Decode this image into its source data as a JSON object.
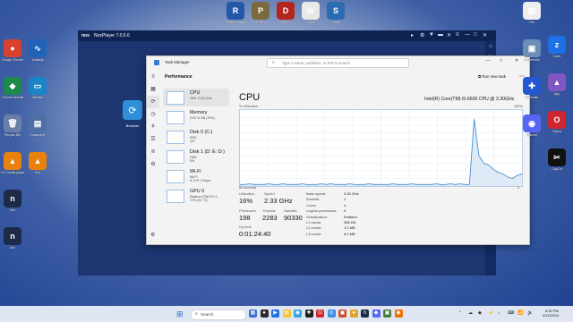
{
  "desktop": {
    "icons_left": [
      {
        "label": "Google Chrome",
        "glyph": "●",
        "color": "#d9412e"
      },
      {
        "label": "Chrome Remote",
        "glyph": "◆",
        "color": "#1d8a4b"
      },
      {
        "label": "Recycle Bin",
        "glyph": "🗑",
        "color": "#6b7ea6"
      },
      {
        "label": "VLC media player",
        "glyph": "▲",
        "color": "#e8820c"
      },
      {
        "label": "Nox",
        "glyph": "n",
        "color": "#1b2b48"
      },
      {
        "label": "Nox",
        "glyph": "n",
        "color": "#1b2b48"
      }
    ],
    "icons_left2": [
      {
        "label": "Audacity",
        "glyph": "∿",
        "color": "#2062b8"
      },
      {
        "label": "Monitor",
        "glyph": "▭",
        "color": "#1a84c9"
      },
      {
        "label": "Document",
        "glyph": "▤",
        "color": "#4d6fa3"
      },
      {
        "label": "VLC",
        "glyph": "▲",
        "color": "#e8820c"
      }
    ],
    "icons_top": [
      {
        "label": "Rocket League",
        "glyph": "R",
        "color": "#2458a8"
      },
      {
        "label": "PUBG",
        "glyph": "P",
        "color": "#7a6a3d"
      },
      {
        "label": "Dota 2",
        "glyph": "D",
        "color": "#b3261e"
      },
      {
        "label": "Game",
        "glyph": "W",
        "color": "#e8e8e8"
      },
      {
        "label": "Game",
        "glyph": "S",
        "color": "#2b6cb0"
      }
    ],
    "icons_right": [
      {
        "label": "File",
        "glyph": "▤",
        "color": "#eeeeee"
      },
      {
        "label": "Screenshot",
        "glyph": "▣",
        "color": "#6b8fb5"
      },
      {
        "label": "Controller",
        "glyph": "✚",
        "color": "#2458d0"
      },
      {
        "label": "Discord",
        "glyph": "◉",
        "color": "#5865f2"
      },
      {
        "label": "Zoom",
        "glyph": "z",
        "color": "#1f6fe5"
      },
      {
        "label": "App",
        "glyph": "▲",
        "color": "#7e57c2"
      },
      {
        "label": "Opera",
        "glyph": "O",
        "color": "#d1262f"
      },
      {
        "label": "CapCut",
        "glyph": "✂",
        "color": "#111111"
      }
    ]
  },
  "nox": {
    "logo": "nox",
    "title": "NoxPlayer 7.0.5.6",
    "controls": [
      "▸",
      "⚙",
      "▼",
      "▬",
      "✕",
      "≡",
      "—",
      "□",
      "✕"
    ],
    "sidebar_tools": [
      "⌂",
      "⇆",
      "▣",
      "⌖",
      "⎙",
      "✂",
      "⊕",
      "⋯",
      "⚙",
      "↩",
      "⌂"
    ],
    "app_label": "Browser",
    "app_glyph": "⟳"
  },
  "task_manager": {
    "title": "Task Manager",
    "search_placeholder": "Type a name, publisher, or PID to search",
    "window_controls": [
      "—",
      "□",
      "✕"
    ],
    "section": "Performance",
    "run_new_task": "Run new task",
    "more": "⋯",
    "rail": [
      "≡",
      "▦",
      "⟳",
      "◷",
      "⚘",
      "☰",
      "≋",
      "⚙"
    ],
    "items": [
      {
        "name": "CPU",
        "sub": "16%  2.33 GHz"
      },
      {
        "name": "Memory",
        "sub": "5.5/7.8 GB (70%)"
      },
      {
        "name": "Disk 0 (C:)",
        "sub": "SSD\n1%"
      },
      {
        "name": "Disk 1 (D: E: D:)",
        "sub": "HDD\n0%"
      },
      {
        "name": "Wi-Fi",
        "sub": "Wi-Fi\nS: 0 R: 0 Kbps"
      },
      {
        "name": "GPU 0",
        "sub": "Radeon (TM) RX 4...\n72% (51 °C)"
      }
    ],
    "cpu_title": "CPU",
    "cpu_model": "Intel(R) Core(TM) i5-6600 CPU @ 3.30GHz",
    "pct_label": "% Utilization",
    "pct_max": "100%",
    "secs": "60 seconds",
    "zero": "0",
    "utilization_series": [
      2,
      2,
      3,
      2,
      2,
      2,
      3,
      2,
      2,
      3,
      2,
      2,
      2,
      3,
      2,
      2,
      2,
      3,
      2,
      3,
      2,
      2,
      2,
      3,
      2,
      2,
      2,
      3,
      2,
      2,
      2,
      2,
      3,
      2,
      2,
      2,
      3,
      2,
      2,
      2,
      2,
      3,
      2,
      2,
      3,
      2,
      3,
      2,
      2,
      88,
      40,
      30,
      28,
      22,
      18,
      16,
      12,
      10,
      14,
      16
    ],
    "stats": {
      "utilization_label": "Utilization",
      "utilization": "16%",
      "speed_label": "Speed",
      "speed": "2.33 GHz",
      "processes_label": "Processes",
      "processes": "198",
      "threads_label": "Threads",
      "threads": "2283",
      "handles_label": "Handles",
      "handles": "90330",
      "uptime_label": "Up time",
      "uptime": "0:01:24:40"
    },
    "specs": [
      {
        "k": "Base speed:",
        "v": "3.30 GHz"
      },
      {
        "k": "Sockets:",
        "v": "1"
      },
      {
        "k": "Cores:",
        "v": "4"
      },
      {
        "k": "Logical processors:",
        "v": "4"
      },
      {
        "k": "Virtualization:",
        "v": "Enabled"
      },
      {
        "k": "L1 cache:",
        "v": "256 KB"
      },
      {
        "k": "L2 cache:",
        "v": "1.0 MB"
      },
      {
        "k": "L3 cache:",
        "v": "6.0 MB"
      }
    ],
    "settings_icon": "⚙"
  },
  "taskbar": {
    "start": "⊞",
    "search_label": "Search",
    "apps": [
      {
        "glyph": "▦",
        "color": "#3b6fd0"
      },
      {
        "glyph": "●",
        "color": "#2c2c2c"
      },
      {
        "glyph": "▶",
        "color": "#1f6fe5"
      },
      {
        "glyph": "▤",
        "color": "#f2c12e"
      },
      {
        "glyph": "◉",
        "color": "#3aa3e3"
      },
      {
        "glyph": "✚",
        "color": "#1e1e1e"
      },
      {
        "glyph": "O",
        "color": "#d1262f"
      },
      {
        "glyph": "◎",
        "color": "#3a8ee6"
      },
      {
        "glyph": "▣",
        "color": "#d14b2a"
      },
      {
        "glyph": "●",
        "color": "#e1a12e"
      },
      {
        "glyph": "n",
        "color": "#1b2b48"
      },
      {
        "glyph": "◆",
        "color": "#5865f2"
      },
      {
        "glyph": "▣",
        "color": "#4a7a3a"
      },
      {
        "glyph": "◉",
        "color": "#ef6c00"
      }
    ],
    "tray": [
      "⌃",
      "☁",
      "◆",
      "⚡",
      "♪",
      "⌨",
      "📶",
      "🔊"
    ],
    "time": "5:32 PM",
    "date": "4/12/2023"
  }
}
